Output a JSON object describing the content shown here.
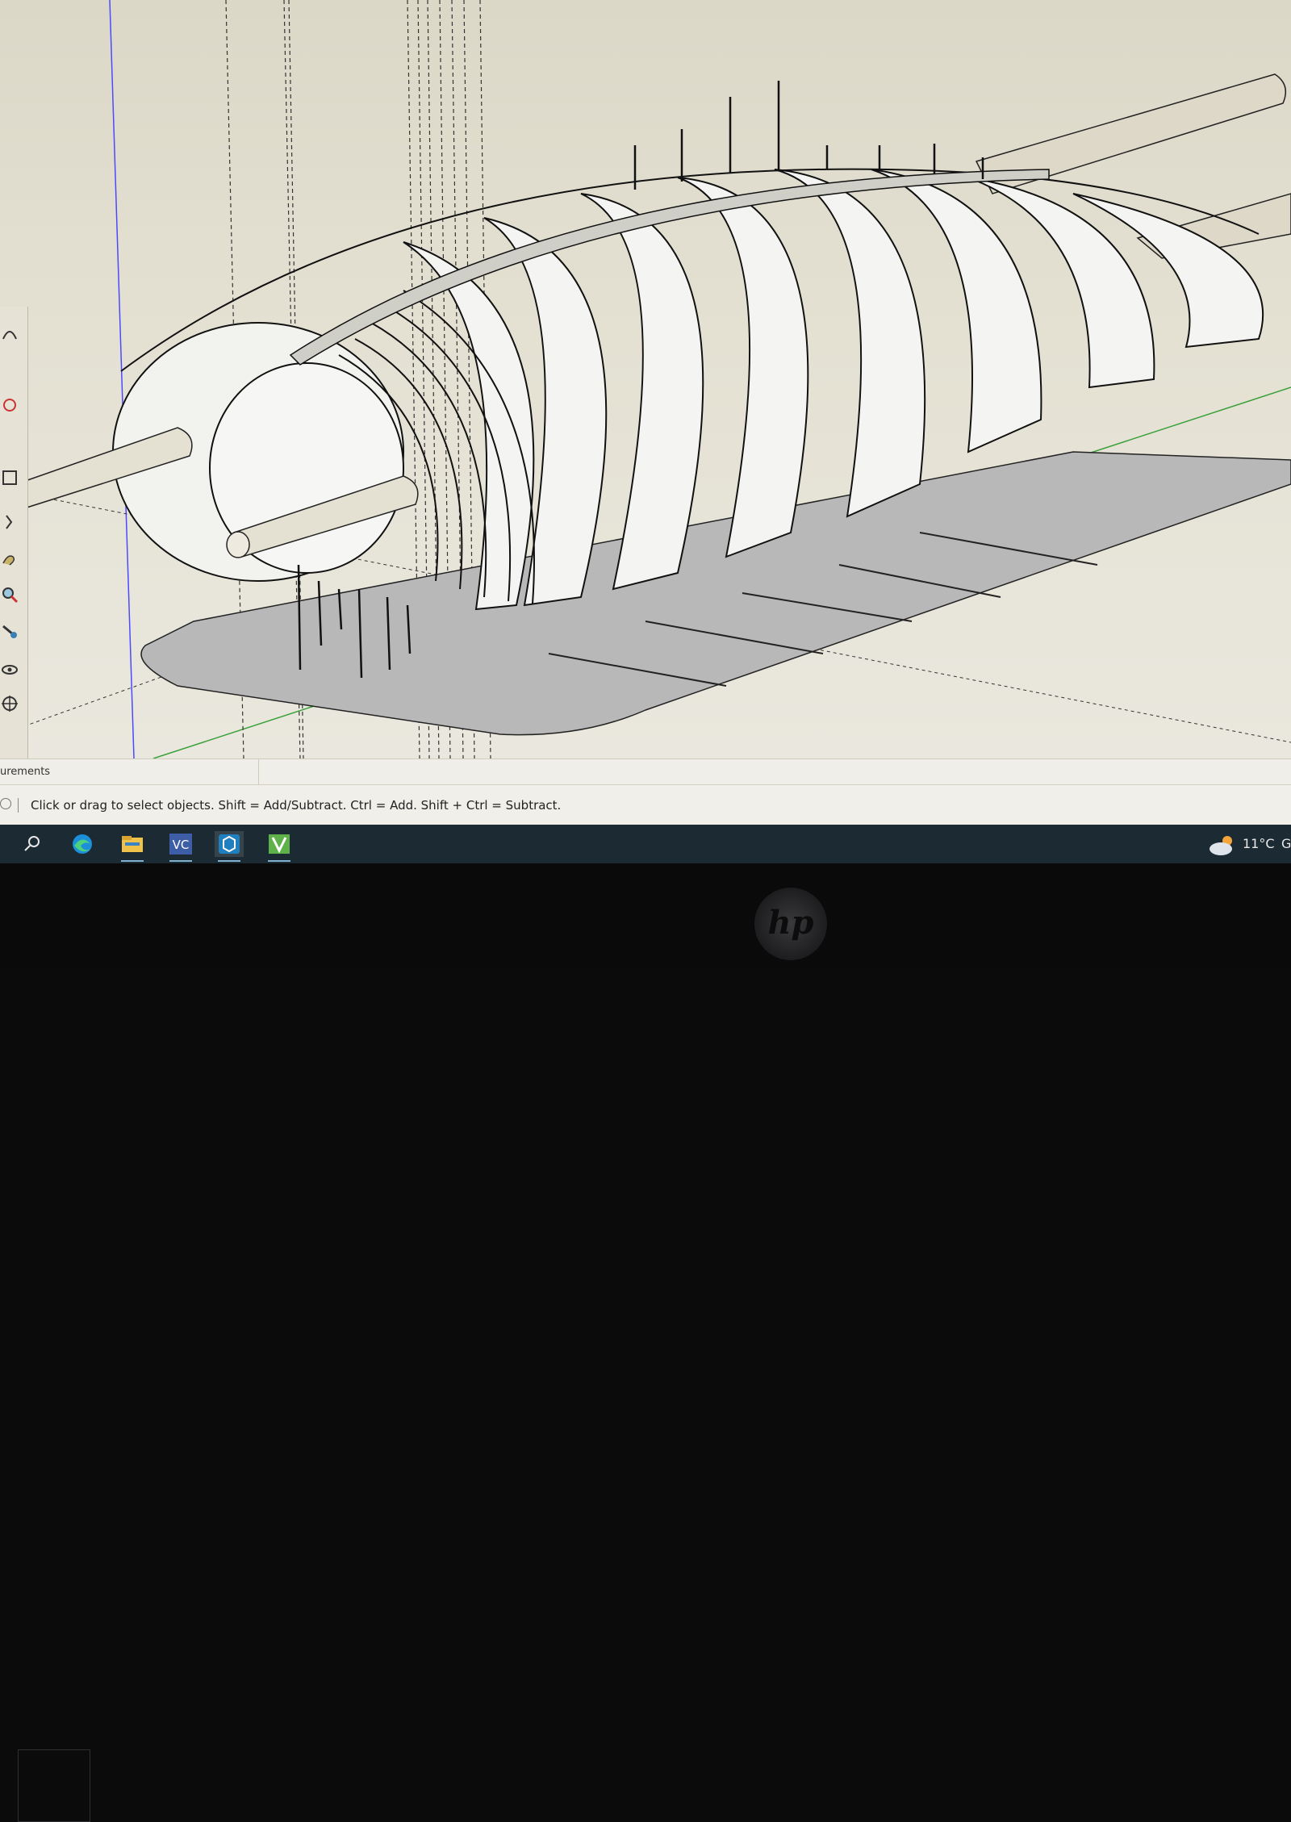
{
  "app": {
    "measurements_label": "urements",
    "status_hint": "Click or drag to select objects. Shift = Add/Subtract. Ctrl = Add. Shift + Ctrl = Subtract."
  },
  "toolbar": {
    "tools": [
      "arc-icon",
      "pencil-icon",
      "tape-icon",
      "walk-icon",
      "zoom-icon",
      "section-icon",
      "look-around-icon",
      "position-camera-icon"
    ]
  },
  "taskbar": {
    "apps": [
      "search-icon",
      "edge-browser-icon",
      "file-explorer-icon",
      "vc-app-icon",
      "sketchup-icon",
      "app-icon"
    ],
    "weather": {
      "icon": "cloud-sun-icon",
      "temperature": "11°C",
      "extra": "G"
    }
  },
  "device": {
    "logo_text": "hp"
  }
}
